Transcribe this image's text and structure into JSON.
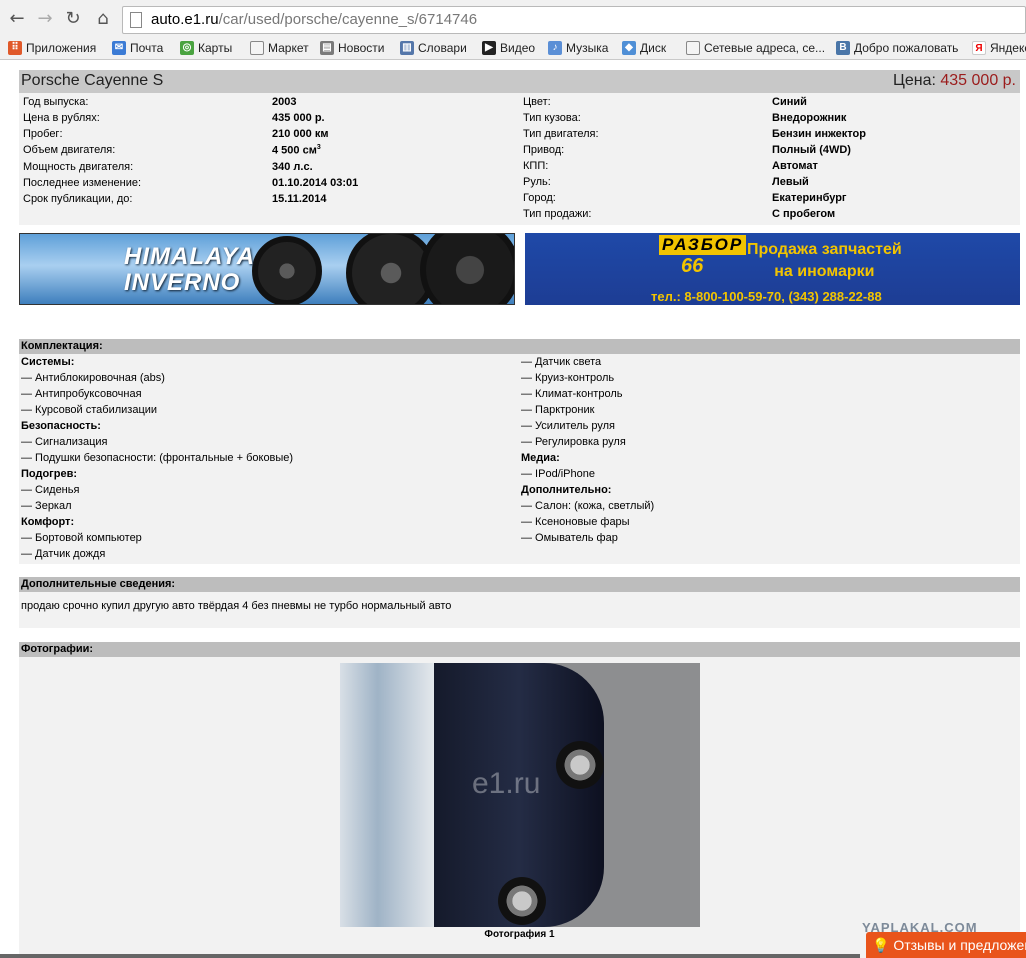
{
  "browser": {
    "url_host": "auto.e1.ru",
    "url_path": "/car/used/porsche/cayenne_s/6714746"
  },
  "bookmarks": [
    {
      "label": "Приложения",
      "icon": "apps-grid-icon"
    },
    {
      "label": "Почта",
      "icon": "mail-icon"
    },
    {
      "label": "Карты",
      "icon": "maps-icon"
    },
    {
      "label": "Маркет",
      "icon": "page-icon"
    },
    {
      "label": "Новости",
      "icon": "news-icon"
    },
    {
      "label": "Словари",
      "icon": "dictionary-icon"
    },
    {
      "label": "Видео",
      "icon": "video-icon"
    },
    {
      "label": "Музыка",
      "icon": "music-icon"
    },
    {
      "label": "Диск",
      "icon": "disk-icon"
    },
    {
      "label": "Сетевые адреса, се...",
      "icon": "page-icon"
    },
    {
      "label": "Добро пожаловать",
      "icon": "vk-icon"
    },
    {
      "label": "Яндекс",
      "icon": "yandex-icon"
    }
  ],
  "listing": {
    "title": "Porsche Cayenne S",
    "price_label": "Цена:",
    "price_value": "435 000 р."
  },
  "specs_left": [
    {
      "label": "Год выпуска:",
      "value": "2003"
    },
    {
      "label": "Цена в рублях:",
      "value": "435 000 р."
    },
    {
      "label": "Пробег:",
      "value": "210 000 км"
    },
    {
      "label": "Объем двигателя:",
      "value": "4 500 см",
      "sup": "3"
    },
    {
      "label": "Мощность двигателя:",
      "value": "340 л.с."
    },
    {
      "label": "Последнее изменение:",
      "value": "01.10.2014 03:01"
    },
    {
      "label": "Срок публикации, до:",
      "value": "15.11.2014"
    }
  ],
  "specs_right": [
    {
      "label": "Цвет:",
      "value": "Синий"
    },
    {
      "label": "Тип кузова:",
      "value": "Внедорожник"
    },
    {
      "label": "Тип двигателя:",
      "value": "Бензин инжектор"
    },
    {
      "label": "Привод:",
      "value": "Полный (4WD)"
    },
    {
      "label": "КПП:",
      "value": "Автомат"
    },
    {
      "label": "Руль:",
      "value": "Левый"
    },
    {
      "label": "Город:",
      "value": "Екатеринбург"
    },
    {
      "label": "Тип продажи:",
      "value": "С пробегом"
    }
  ],
  "banners": {
    "left_line1": "HIMALAYA",
    "left_line2": "INVERNO",
    "right_logo": "РАЗБОР",
    "right_number": "66",
    "right_slogan1": "Продажа запчастей",
    "right_slogan2": "на иномарки",
    "right_phone": "тел.: 8-800-100-59-70, (343) 288-22-88"
  },
  "equipment": {
    "heading": "Комплектация:",
    "left": [
      {
        "text": "Системы:",
        "cat": true
      },
      {
        "text": "— Антиблокировочная (abs)"
      },
      {
        "text": "— Антипробуксовочная"
      },
      {
        "text": "— Курсовой стабилизации"
      },
      {
        "text": "Безопасность:",
        "cat": true
      },
      {
        "text": "— Сигнализация"
      },
      {
        "text": "— Подушки безопасности: (фронтальные + боковые)"
      },
      {
        "text": "Подогрев:",
        "cat": true
      },
      {
        "text": "— Сиденья"
      },
      {
        "text": "— Зеркал"
      },
      {
        "text": "Комфорт:",
        "cat": true
      },
      {
        "text": "— Бортовой компьютер"
      },
      {
        "text": "— Датчик дождя"
      }
    ],
    "right": [
      {
        "text": "— Датчик света"
      },
      {
        "text": "— Круиз-контроль"
      },
      {
        "text": "— Климат-контроль"
      },
      {
        "text": "— Парктроник"
      },
      {
        "text": "— Усилитель руля"
      },
      {
        "text": "— Регулировка руля"
      },
      {
        "text": "Медиа:",
        "cat": true
      },
      {
        "text": "— IPod/iPhone"
      },
      {
        "text": "Дополнительно:",
        "cat": true
      },
      {
        "text": "— Салон: (кожа, светлый)"
      },
      {
        "text": "— Ксеноновые фары"
      },
      {
        "text": "— Омыватель фар"
      }
    ]
  },
  "additional": {
    "heading": "Дополнительные сведения:",
    "text": "продаю срочно купил другую авто твёрдая 4 без пневмы не турбо нормальный авто"
  },
  "photos": {
    "heading": "Фотографии:",
    "watermark": "e1.ru",
    "caption": "Фотография 1"
  },
  "overlay": {
    "yaplakal": "YAPLAKAL.COM",
    "feedback": "Отзывы и предложения"
  }
}
